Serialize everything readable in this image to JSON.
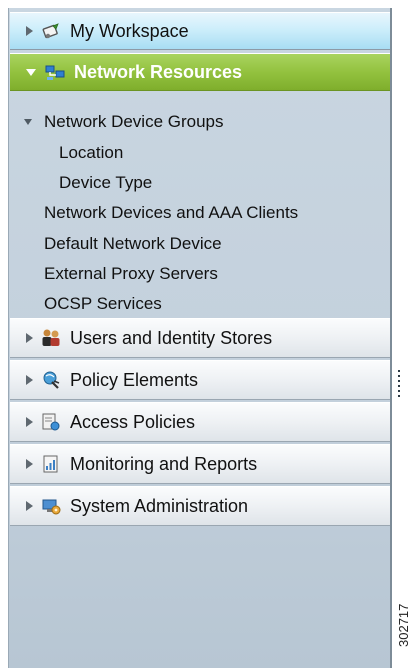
{
  "sidebar": {
    "my_workspace": {
      "label": "My Workspace",
      "icon": "workspace-icon"
    },
    "network_resources": {
      "label": "Network Resources",
      "icon": "network-resources-icon",
      "items": [
        "Network Device Groups",
        "Location",
        "Device Type",
        "Network Devices and AAA Clients",
        "Default Network Device",
        "External Proxy Servers",
        "OCSP Services"
      ]
    },
    "sections": [
      {
        "label": "Users and Identity Stores",
        "icon": "users-icon"
      },
      {
        "label": "Policy Elements",
        "icon": "policy-elements-icon"
      },
      {
        "label": "Access Policies",
        "icon": "access-policies-icon"
      },
      {
        "label": "Monitoring and Reports",
        "icon": "monitoring-icon"
      },
      {
        "label": "System Administration",
        "icon": "system-admin-icon"
      }
    ]
  },
  "figure_id": "302717",
  "colors": {
    "active_header": "#8fbf3c",
    "header_blue": "#bfe7f8",
    "panel_bg": "#c5d2dd"
  }
}
